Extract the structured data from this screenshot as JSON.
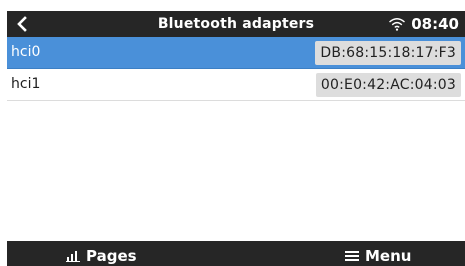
{
  "header": {
    "title": "Bluetooth adapters",
    "time": "08:40",
    "icons": {
      "back": "chevron-left-icon",
      "wifi": "wifi-icon"
    }
  },
  "adapters": [
    {
      "name": "hci0",
      "address": "DB:68:15:18:17:F3",
      "selected": true
    },
    {
      "name": "hci1",
      "address": "00:E0:42:AC:04:03",
      "selected": false
    }
  ],
  "footer": {
    "pages_label": "Pages",
    "menu_label": "Menu",
    "icons": {
      "pages": "bar-chart-icon",
      "menu": "hamburger-menu-icon"
    }
  },
  "colors": {
    "header_bg": "#262626",
    "selected_row": "#4a90d9",
    "value_badge": "#dddddd"
  }
}
